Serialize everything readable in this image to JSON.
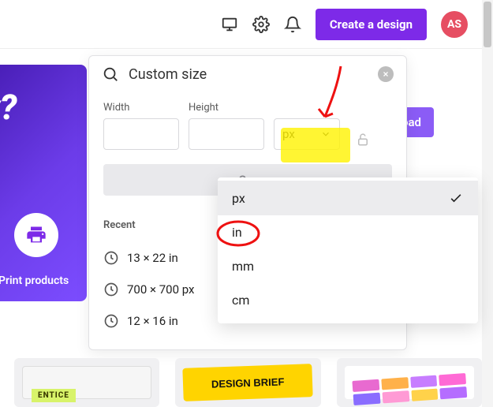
{
  "topbar": {
    "create_label": "Create a design",
    "avatar_initials": "AS"
  },
  "banner": {
    "teaser": "y?",
    "print_label": "Print products",
    "upload_label": "oad"
  },
  "panel": {
    "search_value": "Custom size",
    "width_label": "Width",
    "height_label": "Height",
    "width_value": "",
    "height_value": "",
    "unit_selected": "px",
    "create_button": "Cre",
    "recent_heading": "Recent",
    "recent": [
      {
        "label": "13 × 22 in"
      },
      {
        "label": "700 × 700 px"
      },
      {
        "label": "12 × 16 in"
      }
    ]
  },
  "unit_menu": {
    "options": [
      {
        "label": "px",
        "selected": true
      },
      {
        "label": "in",
        "selected": false
      },
      {
        "label": "mm",
        "selected": false
      },
      {
        "label": "cm",
        "selected": false
      }
    ]
  },
  "thumbs": {
    "t1_tag": "ENTICE",
    "t2_text": "DESIGN BRIEF"
  }
}
